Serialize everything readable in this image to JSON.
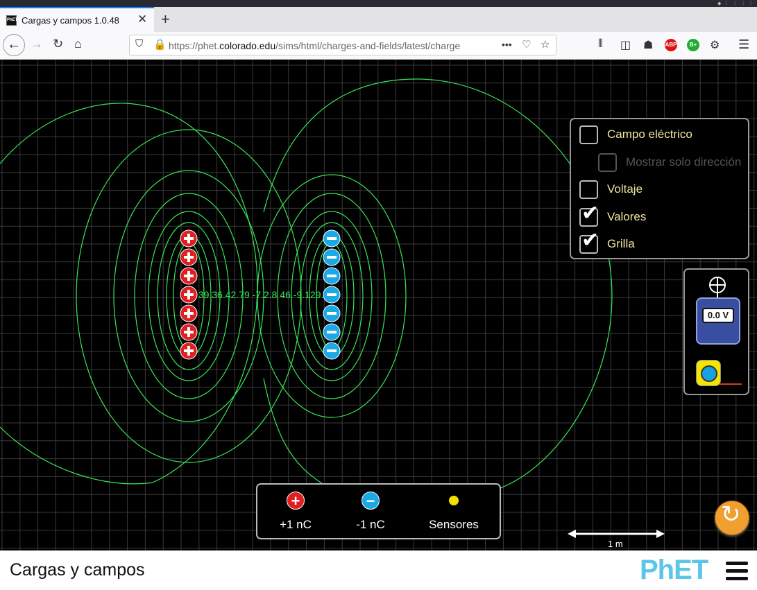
{
  "browser": {
    "tab_title": "Cargas y campos 1.0.48",
    "tab_favicon_text": "PhET",
    "url_prefix": "https://phet.",
    "url_domain": "colorado.edu",
    "url_path": "/sims/html/charges-and-fields/latest/charges-and-fie",
    "url_more": "•••",
    "new_tab": "+",
    "tab_close": "✕",
    "ext_abp": "ABP",
    "ext_b": "B+"
  },
  "controls": {
    "electric_field": {
      "label": "Campo eléctrico",
      "checked": false
    },
    "direction_only": {
      "label": "Mostrar solo dirección",
      "checked": false,
      "disabled": true
    },
    "voltage": {
      "label": "Voltaje",
      "checked": false
    },
    "values": {
      "label": "Valores",
      "checked": true
    },
    "grid": {
      "label": "Grilla",
      "checked": true
    }
  },
  "voltmeter": {
    "reading": "0.0 V"
  },
  "toolbox": {
    "positive": {
      "symbol": "+",
      "label": "+1 nC"
    },
    "negative": {
      "symbol": "−",
      "label": "-1 nC"
    },
    "sensors": {
      "label": "Sensores"
    }
  },
  "scale": {
    "label": "1 m"
  },
  "equipotential_labels": "39.36.42.79 -7.2.8 46.-9.129.0",
  "footer": {
    "title": "Cargas y campos",
    "brand": "PhET"
  },
  "charges": {
    "positive_count": 7,
    "negative_count": 7
  },
  "colors": {
    "field_line": "#39e65a",
    "positive": "#e02020",
    "negative": "#1aa8e6",
    "label_text": "#f2e3a0"
  }
}
